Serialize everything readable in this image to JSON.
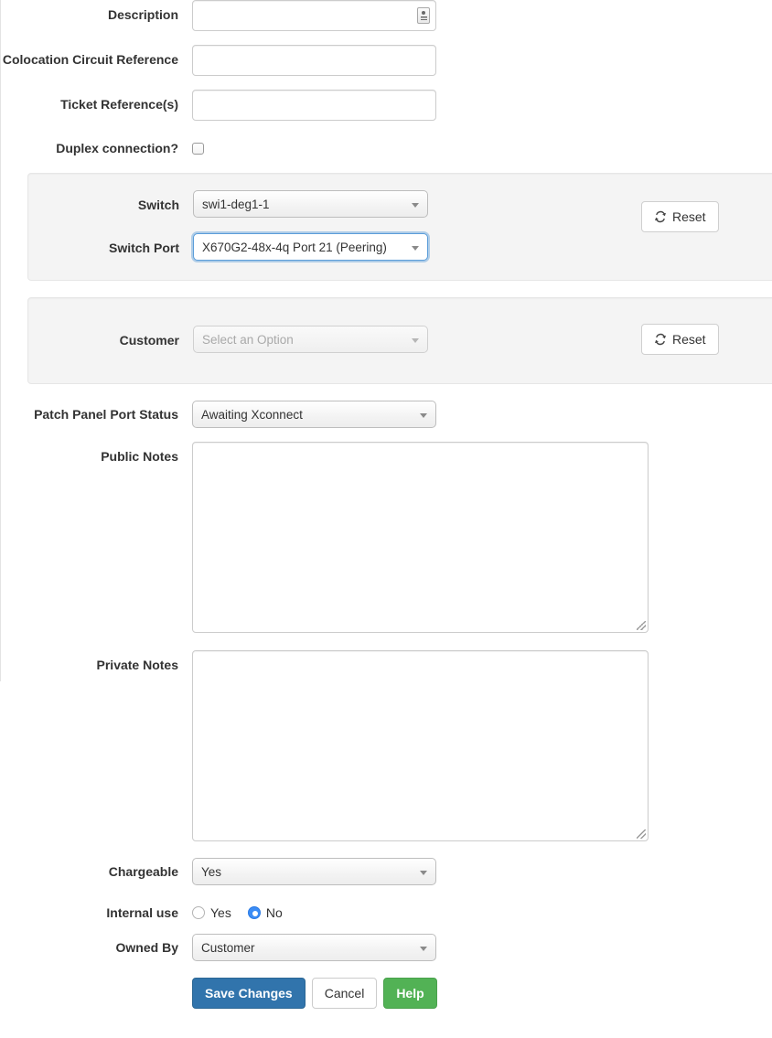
{
  "form": {
    "description": {
      "label": "Description",
      "value": "",
      "placeholder": "",
      "autofill_icon": "autofill-card-icon"
    },
    "colocation_circuit_reference": {
      "label": "Colocation Circuit Reference",
      "value": "",
      "placeholder": ""
    },
    "ticket_references": {
      "label": "Ticket Reference(s)",
      "value": "",
      "placeholder": ""
    },
    "duplex_connection": {
      "label": "Duplex connection?",
      "checked": false
    },
    "switch_panel": {
      "switch": {
        "label": "Switch",
        "value": "swi1-deg1-1",
        "disabled": false,
        "focused": false
      },
      "switch_port": {
        "label": "Switch Port",
        "value": "X670G2-48x-4q Port 21 (Peering)",
        "disabled": false,
        "focused": true
      },
      "reset_label": "Reset",
      "reset_icon": "refresh-icon"
    },
    "customer_panel": {
      "customer": {
        "label": "Customer",
        "value": "Select an Option",
        "disabled": true,
        "focused": false
      },
      "reset_label": "Reset",
      "reset_icon": "refresh-icon"
    },
    "patch_panel_port_status": {
      "label": "Patch Panel Port Status",
      "value": "Awaiting Xconnect"
    },
    "public_notes": {
      "label": "Public Notes",
      "value": "",
      "placeholder": ""
    },
    "private_notes": {
      "label": "Private Notes",
      "value": "",
      "placeholder": ""
    },
    "chargeable": {
      "label": "Chargeable",
      "value": "Yes"
    },
    "internal_use": {
      "label": "Internal use",
      "options": [
        {
          "label": "Yes",
          "checked": false
        },
        {
          "label": "No",
          "checked": true
        }
      ]
    },
    "owned_by": {
      "label": "Owned By",
      "value": "Customer"
    },
    "actions": {
      "save_label": "Save Changes",
      "cancel_label": "Cancel",
      "help_label": "Help"
    }
  },
  "colors": {
    "primary": "#3174ac",
    "success": "#52b255",
    "focus_blue": "#5b9dd9",
    "radio_selected": "#3b8cf5",
    "panel_bg": "#f4f4f4",
    "border": "#cccccc"
  }
}
